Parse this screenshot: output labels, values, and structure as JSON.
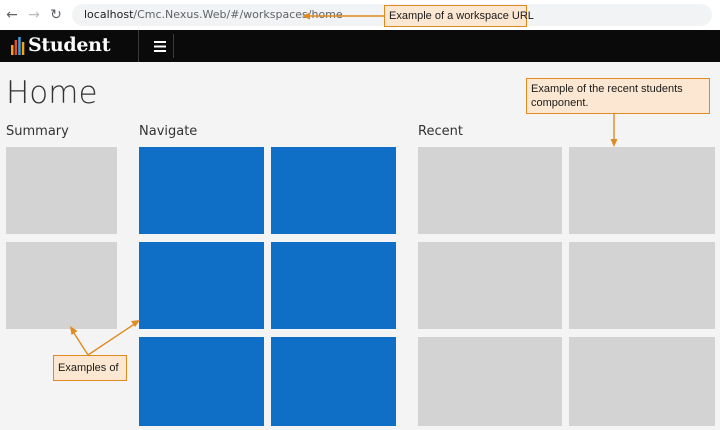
{
  "browser": {
    "url_host": "localhost",
    "url_path": "/Cmc.Nexus.Web/#/workspaces/home",
    "back_icon": "←",
    "forward_icon": "→",
    "reload_icon": "↻"
  },
  "app": {
    "logo_text": "Student",
    "menu_icon": "hamburger-menu"
  },
  "page": {
    "title": "Home",
    "sections": {
      "summary": "Summary",
      "navigate": "Navigate",
      "recent": "Recent"
    }
  },
  "annotations": {
    "url_note": "Example of a workspace URL",
    "recent_note": "Example of the recent students component.",
    "examples_note": "Examples of"
  },
  "colors": {
    "app_bar": "#0a0a0a",
    "navigate_tile": "#0f6fc6",
    "placeholder_tile": "#d3d3d3",
    "callout_fill": "#fce8d2",
    "callout_border": "#e08a22",
    "logo_bars": [
      "#f6a21a",
      "#e8492b",
      "#3aa0d8",
      "#f6a21a"
    ]
  }
}
